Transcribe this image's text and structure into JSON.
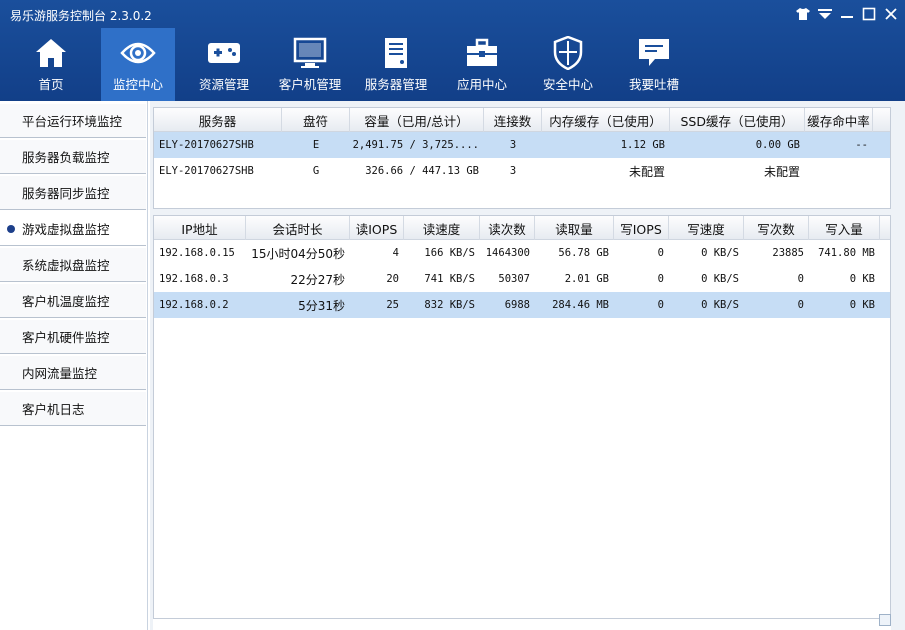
{
  "window": {
    "title": "易乐游服务控制台 2.3.0.2"
  },
  "nav": [
    {
      "label": "首页",
      "icon": "home-icon"
    },
    {
      "label": "监控中心",
      "icon": "eye-icon"
    },
    {
      "label": "资源管理",
      "icon": "gamepad-icon"
    },
    {
      "label": "客户机管理",
      "icon": "monitor-icon"
    },
    {
      "label": "服务器管理",
      "icon": "server-icon"
    },
    {
      "label": "应用中心",
      "icon": "toolbox-icon"
    },
    {
      "label": "安全中心",
      "icon": "shield-icon"
    },
    {
      "label": "我要吐槽",
      "icon": "feedback-icon"
    }
  ],
  "sidebar": {
    "items": [
      {
        "label": "平台运行环境监控"
      },
      {
        "label": "服务器负载监控"
      },
      {
        "label": "服务器同步监控"
      },
      {
        "label": "游戏虚拟盘监控"
      },
      {
        "label": "系统虚拟盘监控"
      },
      {
        "label": "客户机温度监控"
      },
      {
        "label": "客户机硬件监控"
      },
      {
        "label": "内网流量监控"
      },
      {
        "label": "客户机日志"
      }
    ]
  },
  "disk_table": {
    "headers": [
      "服务器",
      "盘符",
      "容量（已用/总计）",
      "连接数",
      "内存缓存（已使用）",
      "SSD缓存（已使用）",
      "缓存命中率"
    ],
    "rows": [
      [
        "ELY-20170627SHB",
        "E",
        "2,491.75 / 3,725....",
        "3",
        "1.12 GB",
        "0.00 GB",
        "--"
      ],
      [
        "ELY-20170627SHB",
        "G",
        "326.66 / 447.13 GB",
        "3",
        "未配置",
        "未配置",
        ""
      ]
    ]
  },
  "session_table": {
    "headers": [
      "IP地址",
      "会话时长",
      "读IOPS",
      "读速度",
      "读次数",
      "读取量",
      "写IOPS",
      "写速度",
      "写次数",
      "写入量"
    ],
    "rows": [
      [
        "192.168.0.15",
        "15小时04分50秒",
        "4",
        "166 KB/S",
        "1464300",
        "56.78 GB",
        "0",
        "0 KB/S",
        "23885",
        "741.80 MB"
      ],
      [
        "192.168.0.3",
        "22分27秒",
        "20",
        "741 KB/S",
        "50307",
        "2.01 GB",
        "0",
        "0 KB/S",
        "0",
        "0 KB"
      ],
      [
        "192.168.0.2",
        "5分31秒",
        "25",
        "832 KB/S",
        "6988",
        "284.46 MB",
        "0",
        "0 KB/S",
        "0",
        "0 KB"
      ]
    ]
  },
  "colors": {
    "header": "#1a4f9c",
    "nav_active": "#2f70c8",
    "selection": "#c6ddf5",
    "sidebar_dot": "#1d3f8a"
  }
}
